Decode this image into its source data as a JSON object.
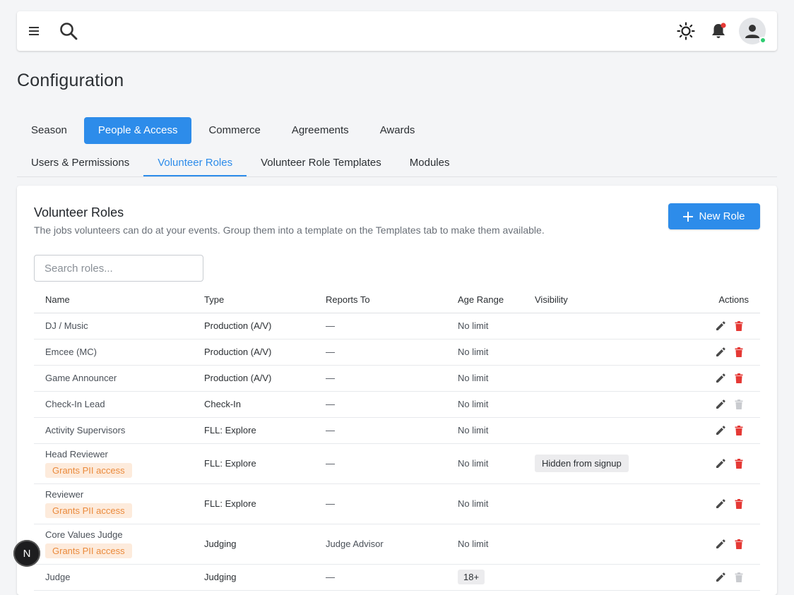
{
  "page": {
    "title": "Configuration"
  },
  "main_tabs": [
    {
      "label": "Season",
      "active": false
    },
    {
      "label": "People & Access",
      "active": true
    },
    {
      "label": "Commerce",
      "active": false
    },
    {
      "label": "Agreements",
      "active": false
    },
    {
      "label": "Awards",
      "active": false
    }
  ],
  "sub_tabs": [
    {
      "label": "Users & Permissions",
      "active": false
    },
    {
      "label": "Volunteer Roles",
      "active": true
    },
    {
      "label": "Volunteer Role Templates",
      "active": false
    },
    {
      "label": "Modules",
      "active": false
    }
  ],
  "card": {
    "title": "Volunteer Roles",
    "subtitle": "The jobs volunteers can do at your events. Group them into a template on the Templates tab to make them available.",
    "new_button": "New Role",
    "search_placeholder": "Search roles..."
  },
  "table": {
    "headers": {
      "name": "Name",
      "type": "Type",
      "reports": "Reports To",
      "age": "Age Range",
      "visibility": "Visibility",
      "actions": "Actions"
    },
    "rows": [
      {
        "name": "DJ / Music",
        "pii": "",
        "type": "Production (A/V)",
        "reports": "—",
        "age": "No limit",
        "age_badge": "",
        "visibility": "",
        "delete_enabled": true
      },
      {
        "name": "Emcee (MC)",
        "pii": "",
        "type": "Production (A/V)",
        "reports": "—",
        "age": "No limit",
        "age_badge": "",
        "visibility": "",
        "delete_enabled": true
      },
      {
        "name": "Game Announcer",
        "pii": "",
        "type": "Production (A/V)",
        "reports": "—",
        "age": "No limit",
        "age_badge": "",
        "visibility": "",
        "delete_enabled": true
      },
      {
        "name": "Check-In Lead",
        "pii": "",
        "type": "Check-In",
        "reports": "—",
        "age": "No limit",
        "age_badge": "",
        "visibility": "",
        "delete_enabled": false
      },
      {
        "name": "Activity Supervisors",
        "pii": "",
        "type": "FLL: Explore",
        "reports": "—",
        "age": "No limit",
        "age_badge": "",
        "visibility": "",
        "delete_enabled": true
      },
      {
        "name": "Head Reviewer",
        "pii": "Grants PII access",
        "type": "FLL: Explore",
        "reports": "—",
        "age": "No limit",
        "age_badge": "",
        "visibility": "Hidden from signup",
        "delete_enabled": true
      },
      {
        "name": "Reviewer",
        "pii": "Grants PII access",
        "type": "FLL: Explore",
        "reports": "—",
        "age": "No limit",
        "age_badge": "",
        "visibility": "",
        "delete_enabled": true
      },
      {
        "name": "Core Values Judge",
        "pii": "Grants PII access",
        "type": "Judging",
        "reports": "Judge Advisor",
        "age": "No limit",
        "age_badge": "",
        "visibility": "",
        "delete_enabled": true
      },
      {
        "name": "Judge",
        "pii": "",
        "type": "Judging",
        "reports": "—",
        "age": "",
        "age_badge": "18+",
        "visibility": "",
        "delete_enabled": false
      }
    ]
  },
  "floating_badge": "N",
  "colors": {
    "accent": "#2d8cea",
    "danger": "#e53935",
    "pii_text": "#ea8a3c",
    "pii_bg": "#fdebdc",
    "online": "#2ecc71",
    "notification": "#e53935"
  },
  "icons": {
    "menu": "hamburger-icon",
    "search": "search-icon",
    "theme": "sun-icon",
    "notifications": "bell-icon",
    "user": "user-icon",
    "edit": "pencil-icon",
    "delete": "trash-icon",
    "add": "plus-icon"
  }
}
